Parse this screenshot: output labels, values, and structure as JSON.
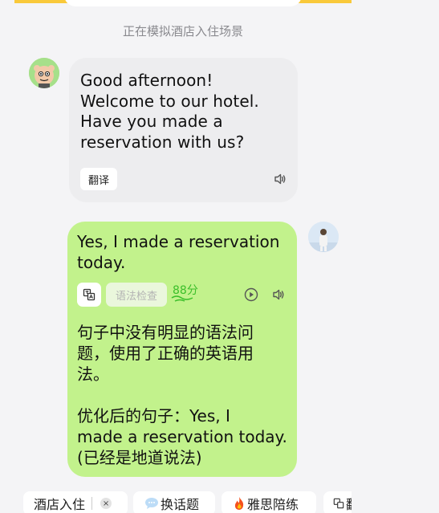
{
  "status_text": "正在模拟酒店入住场景",
  "bot_message": {
    "lines": [
      "Good afternoon!",
      "Welcome to our hotel.",
      "Have you made a",
      "reservation with us?"
    ],
    "translate_label": "翻译"
  },
  "user_message": {
    "lines": [
      "Yes, I made a reservation",
      "today."
    ],
    "grammar_check_label": "语法检查",
    "score": "88分",
    "feedback_lines": [
      "句子中没有明显的语法问",
      "题，使用了正确的英语用",
      "法。"
    ],
    "improved_lines": [
      "优化后的句子：Yes, I",
      "made a reservation today.",
      "(已经是地道说法)"
    ]
  },
  "bottom_bar": {
    "scene_chip_label": "酒店入住",
    "scene_chip_close": "×",
    "change_topic_label": "换话题",
    "ielts_label": "雅思陪练",
    "cut_off_label": "翻"
  },
  "colors": {
    "accent_yellow": "#f9c93a",
    "user_bubble": "#c2f28c",
    "bot_bubble": "#ededef",
    "score_green": "#3bbf2a"
  },
  "icons": [
    "speaker-icon",
    "copy-translate-icon",
    "play-icon",
    "speech-bubble-icon",
    "fire-icon",
    "close-icon"
  ]
}
